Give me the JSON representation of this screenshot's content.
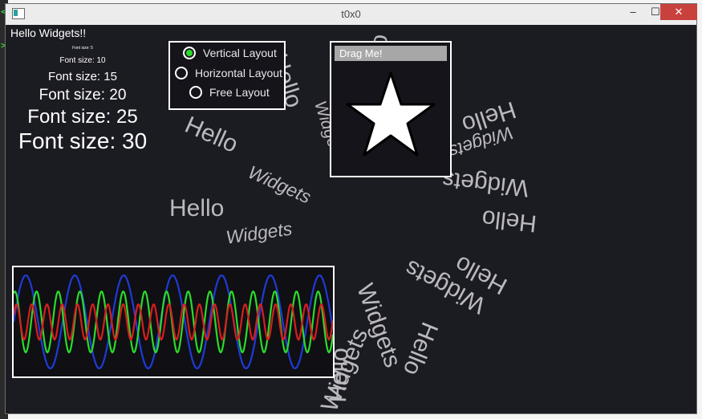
{
  "window": {
    "title": "t0x0",
    "minimize": "–",
    "maximize": "☐",
    "close": "✕"
  },
  "app": {
    "heading": "Hello Widgets!!"
  },
  "font_sizes": [
    {
      "label": "Font size: 5",
      "size": 5
    },
    {
      "label": "Font size: 10",
      "size": 10
    },
    {
      "label": "Font size: 15",
      "size": 15
    },
    {
      "label": "Font size: 20",
      "size": 20
    },
    {
      "label": "Font size: 25",
      "size": 25
    },
    {
      "label": "Font size: 30",
      "size": 30
    }
  ],
  "layout_options": [
    {
      "label": "Vertical Layout",
      "selected": true
    },
    {
      "label": "Horizontal Layout",
      "selected": false
    },
    {
      "label": "Free Layout",
      "selected": false
    }
  ],
  "drag_panel": {
    "label": "Drag Me!"
  },
  "ghost_words": [
    "Hello",
    "Widgets"
  ],
  "colors": {
    "background": "#1b1b22",
    "radio_selected": "#2adb2a",
    "wave_blue": "#1f3bd6",
    "wave_green": "#2adb2a",
    "wave_red": "#d81e1e"
  }
}
